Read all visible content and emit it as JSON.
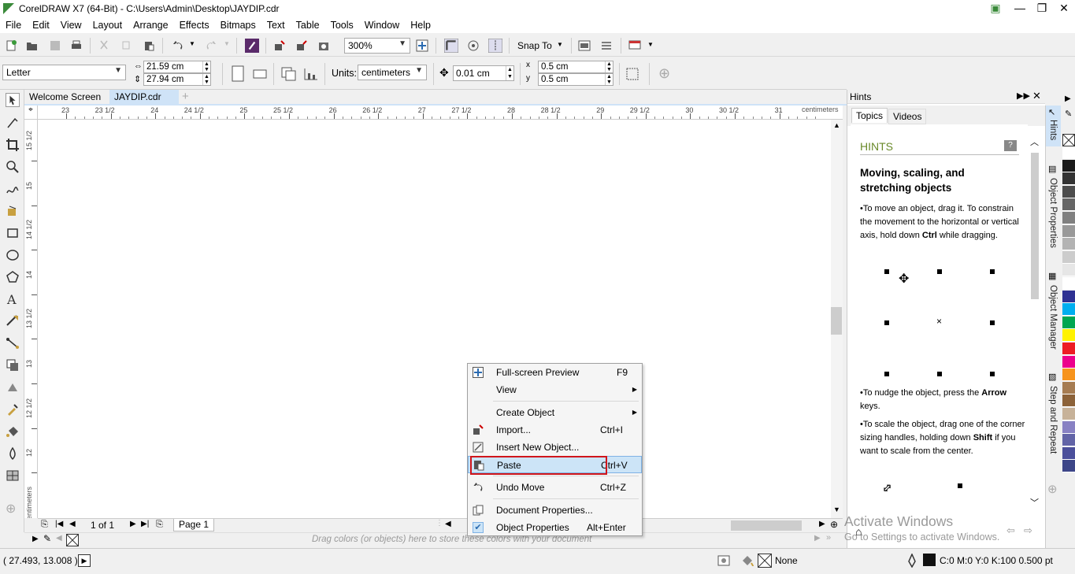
{
  "window": {
    "title": "CorelDRAW X7 (64-Bit) - C:\\Users\\Admin\\Desktop\\JAYDIP.cdr",
    "minimize": "—",
    "maximize": "❐",
    "close": "✕"
  },
  "menu": [
    "File",
    "Edit",
    "View",
    "Layout",
    "Arrange",
    "Effects",
    "Bitmaps",
    "Text",
    "Table",
    "Tools",
    "Window",
    "Help"
  ],
  "toolbar": {
    "zoom": "300%",
    "snap": "Snap To"
  },
  "propbar": {
    "page_size": "Letter",
    "width": "21.59 cm",
    "height": "27.94 cm",
    "units_label": "Units:",
    "units": "centimeters",
    "nudge": "0.01 cm",
    "dup_x": "0.5 cm",
    "dup_y": "0.5 cm"
  },
  "tabs": {
    "welcome": "Welcome Screen",
    "doc": "JAYDIP.cdr",
    "add": "+"
  },
  "ruler": {
    "h_ticks": [
      "23",
      "23 1/2",
      "24",
      "24 1/2",
      "25",
      "25 1/2",
      "26",
      "26 1/2",
      "27",
      "27 1/2",
      "28",
      "28 1/2",
      "29",
      "29 1/2",
      "30",
      "30 1/2",
      "31"
    ],
    "h_unit": "centimeters",
    "v_ticks": [
      "15 1/2",
      "15",
      "14 1/2",
      "14",
      "13 1/2",
      "13",
      "12 1/2",
      "12"
    ],
    "v_unit": "centimeters"
  },
  "pagenav": {
    "count": "1 of 1",
    "page_tab": "Page 1"
  },
  "palette_hint": "Drag colors (or objects) here to store these colors with your document",
  "context_menu": {
    "items": [
      {
        "label": "Full-screen Preview",
        "shortcut": "F9"
      },
      {
        "label": "View",
        "shortcut": ""
      },
      {
        "label": "Create Object",
        "shortcut": ""
      },
      {
        "label": "Import...",
        "shortcut": "Ctrl+I"
      },
      {
        "label": "Insert New Object...",
        "shortcut": ""
      },
      {
        "label": "Paste",
        "shortcut": "Ctrl+V"
      },
      {
        "label": "Undo Move",
        "shortcut": "Ctrl+Z"
      },
      {
        "label": "Document Properties...",
        "shortcut": ""
      },
      {
        "label": "Object Properties",
        "shortcut": "Alt+Enter"
      }
    ]
  },
  "hints": {
    "panel_title": "Hints",
    "tab_topics": "Topics",
    "tab_videos": "Videos",
    "heading": "HINTS",
    "title": "Moving, scaling, and stretching objects",
    "p1_a": "•To move an object, drag it. To constrain the movement to the horizontal or vertical axis, hold down ",
    "p1_b": "Ctrl",
    "p1_c": " while dragging.",
    "p2_a": "•To nudge the object, press the ",
    "p2_b": "Arrow",
    "p2_c": " keys.",
    "p3_a": "•To scale the object, drag one of the corner sizing handles, holding down ",
    "p3_b": "Shift",
    "p3_c": " if you want to scale from the center."
  },
  "dock_tabs": [
    "Hints",
    "Object Properties",
    "Object Manager",
    "Step and Repeat"
  ],
  "watermark": {
    "line1": "Activate Windows",
    "line2": "Go to Settings to activate Windows."
  },
  "status": {
    "coords": "( 27.493, 13.008 )",
    "fill": "None",
    "outline": "C:0 M:0 Y:0 K:100  0.500 pt"
  },
  "palette_colors": [
    "#ffffff",
    "#1a1a1a",
    "#333333",
    "#4d4d4d",
    "#666666",
    "#808080",
    "#999999",
    "#b3b3b3",
    "#cccccc",
    "#e6e6e6",
    "#ffffff",
    "#2e3192",
    "#00aeef",
    "#00a651",
    "#fff200",
    "#ed1c24",
    "#ec008c",
    "#f7941d",
    "#a67c52",
    "#8c6239",
    "#c7b299",
    "#8881c3",
    "#6264a7",
    "#4b4f9b",
    "#3d4688"
  ]
}
